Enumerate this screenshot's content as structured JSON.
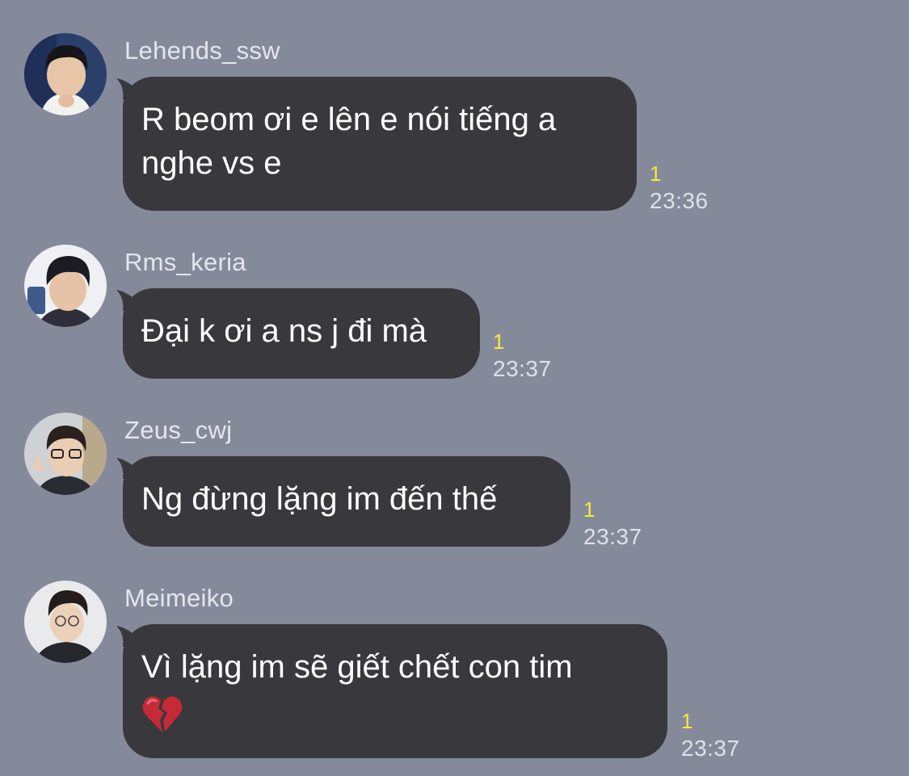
{
  "messages": [
    {
      "sender": "Lehends_ssw",
      "avatar_icon": "avatar-photo-icon",
      "text": "R beom ơi e lên e nói tiếng a\nnghe vs e",
      "read_count": "1",
      "time": "23:36"
    },
    {
      "sender": "Rms_keria",
      "avatar_icon": "avatar-photo-icon",
      "text": "Đại k ơi a ns j đi mà",
      "read_count": "1",
      "time": "23:37"
    },
    {
      "sender": "Zeus_cwj",
      "avatar_icon": "avatar-photo-icon",
      "text": "Ng đừng lặng im đến thế",
      "read_count": "1",
      "time": "23:37"
    },
    {
      "sender": "Meimeiko",
      "avatar_icon": "avatar-photo-icon",
      "text": "Vì lặng im sẽ giết chết con tim",
      "emoji": "broken-heart-icon",
      "read_count": "1",
      "time": "23:37"
    }
  ],
  "colors": {
    "background": "#858a9b",
    "bubble": "#39393d",
    "read_count": "#f5ea3a"
  }
}
